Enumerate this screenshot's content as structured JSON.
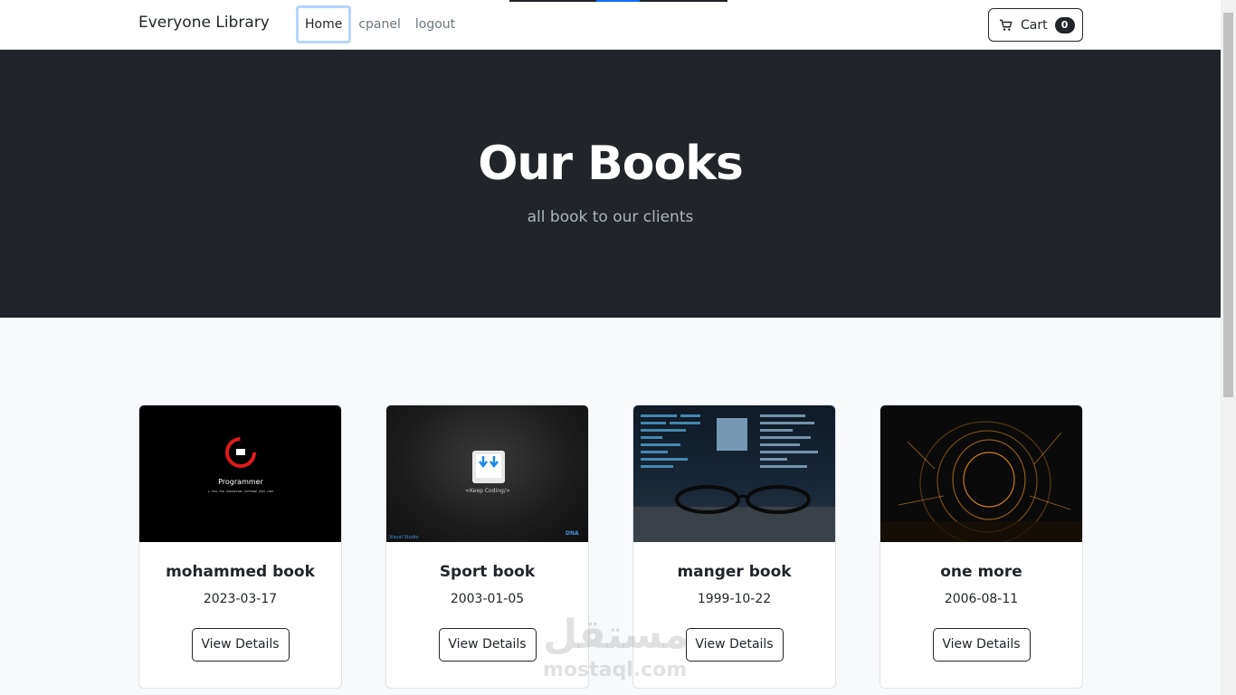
{
  "navbar": {
    "brand": "Everyone Library",
    "links": [
      {
        "label": "Home",
        "active": true
      },
      {
        "label": "cpanel",
        "active": false
      },
      {
        "label": "logout",
        "active": false
      }
    ],
    "cart_label": "Cart",
    "cart_count": "0",
    "cart_icon": "cart-icon"
  },
  "hero": {
    "title": "Our Books",
    "subtitle": "all book to our clients"
  },
  "books": [
    {
      "title": "mohammed book",
      "date": "2023-03-17",
      "button": "View Details",
      "image_caption": "Programmer",
      "image_tagline": "A TOOL FOR CONVERTING CAFFEINE INTO CODE"
    },
    {
      "title": "Sport book",
      "date": "2003-01-05",
      "button": "View Details",
      "image_caption": "<Keep Coding/>",
      "image_corner_left": "Visual Studio",
      "image_corner_right": "DNA"
    },
    {
      "title": "manger book",
      "date": "1999-10-22",
      "button": "View Details"
    },
    {
      "title": "one more",
      "date": "2006-08-11",
      "button": "View Details"
    }
  ],
  "watermark": {
    "text": "مستقل",
    "sub": "mostaql.com"
  },
  "colors": {
    "dark": "#212529",
    "background": "#f8f9fa",
    "accent": "#0d6efd",
    "focus_ring": "#b6d4fe"
  }
}
